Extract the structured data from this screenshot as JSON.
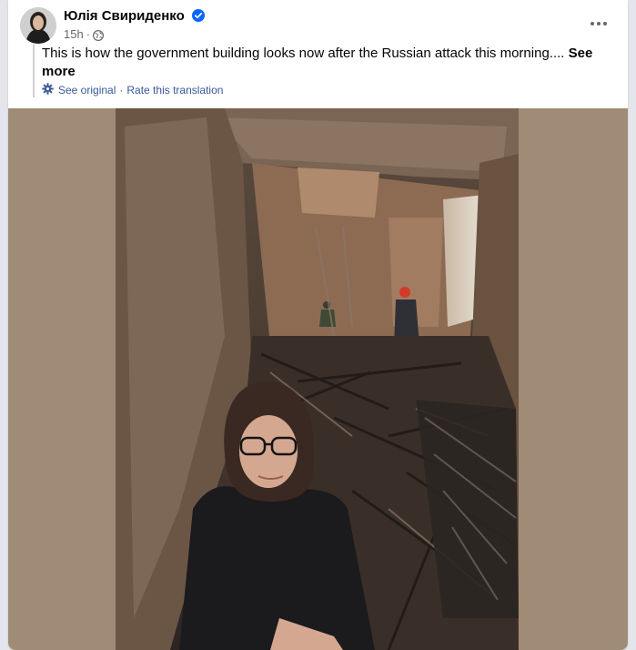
{
  "post": {
    "author": "Юлія Свириденко",
    "time": "15h",
    "dot": "·",
    "text": "This is how the government building looks now after the Russian attack this morning....",
    "see_more": "See more",
    "translation_links": {
      "see_original": "See original",
      "separator": "·",
      "rate": "Rate this translation"
    }
  },
  "icons": {
    "verified": "verified-badge-icon",
    "privacy": "globe-icon",
    "more": "more-options-icon",
    "translate": "translate-settings-icon"
  },
  "colors": {
    "link": "#385898",
    "verified": "#0866ff",
    "photo_background": "#a08c76"
  }
}
